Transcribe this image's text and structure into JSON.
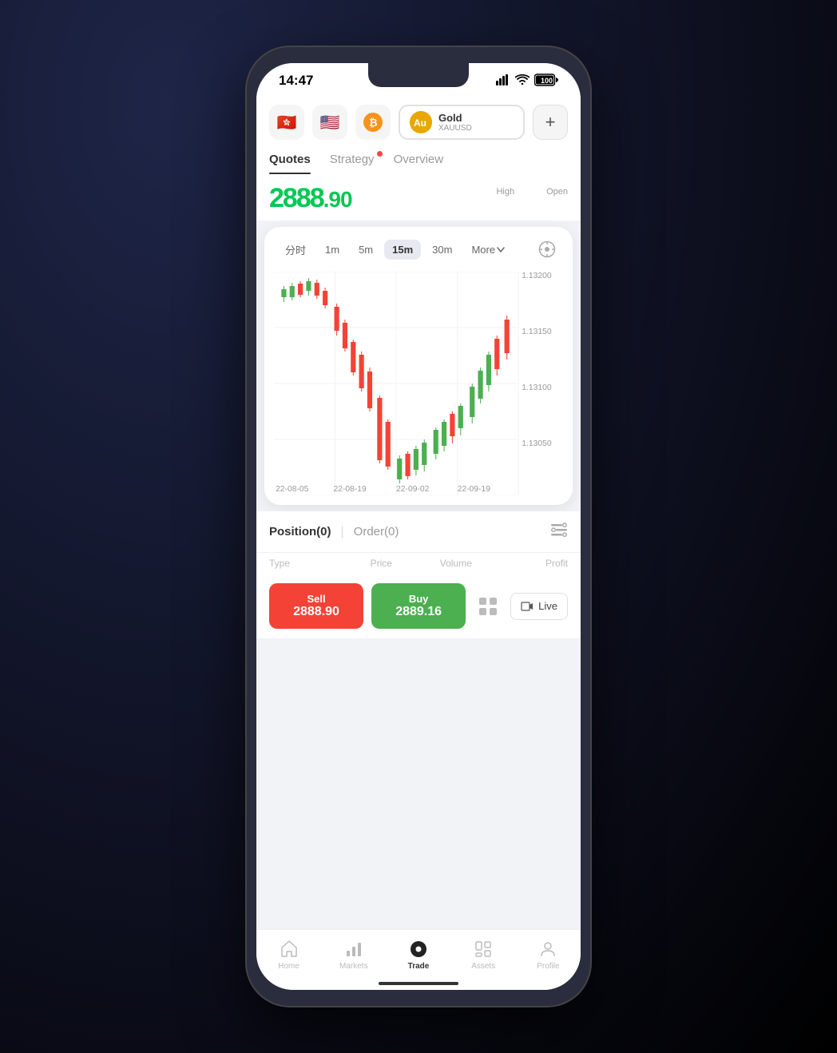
{
  "status": {
    "time": "14:47",
    "signal": "▲▲▲▲",
    "wifi": "wifi",
    "battery": "100"
  },
  "assets": [
    {
      "id": "hk",
      "icon": "🇭🇰",
      "label": "HK"
    },
    {
      "id": "us",
      "icon": "🇺🇸",
      "label": "US"
    },
    {
      "id": "btc",
      "icon": "₿",
      "label": "BTC"
    }
  ],
  "active_asset": {
    "icon": "Au",
    "name": "Gold",
    "symbol": "XAUUSD"
  },
  "nav_tabs": [
    {
      "id": "quotes",
      "label": "Quotes",
      "active": true
    },
    {
      "id": "strategy",
      "label": "Strategy",
      "has_dot": true
    },
    {
      "id": "overview",
      "label": "Overview"
    }
  ],
  "price": {
    "current": "2888.90",
    "high_label": "High",
    "open_label": "Open"
  },
  "chart": {
    "timeframes": [
      {
        "id": "fen",
        "label": "分时"
      },
      {
        "id": "1m",
        "label": "1m"
      },
      {
        "id": "5m",
        "label": "5m"
      },
      {
        "id": "15m",
        "label": "15m",
        "active": true
      },
      {
        "id": "30m",
        "label": "30m"
      },
      {
        "id": "more",
        "label": "More"
      }
    ],
    "price_levels": [
      "1.13200",
      "1.13150",
      "1.13100",
      "1.13050"
    ],
    "date_labels": [
      "22-08-05",
      "22-08-19",
      "22-09-02",
      "22-09-19"
    ]
  },
  "positions": {
    "position_tab": "Position(0)",
    "order_tab": "Order(0)"
  },
  "table_headers": {
    "type": "Type",
    "price": "Price",
    "volume": "Volume",
    "profit": "Profit"
  },
  "trade": {
    "sell_label": "Sell",
    "sell_price": "2888.90",
    "buy_label": "Buy",
    "buy_price": "2889.16",
    "live_label": "Live"
  },
  "bottom_nav": [
    {
      "id": "home",
      "label": "Home",
      "icon": "⌂"
    },
    {
      "id": "markets",
      "label": "Markets",
      "icon": "📊"
    },
    {
      "id": "trade",
      "label": "Trade",
      "icon": "●",
      "active": true
    },
    {
      "id": "assets",
      "label": "Assets",
      "icon": "▦"
    },
    {
      "id": "profile",
      "label": "Profile",
      "icon": "👤"
    }
  ]
}
